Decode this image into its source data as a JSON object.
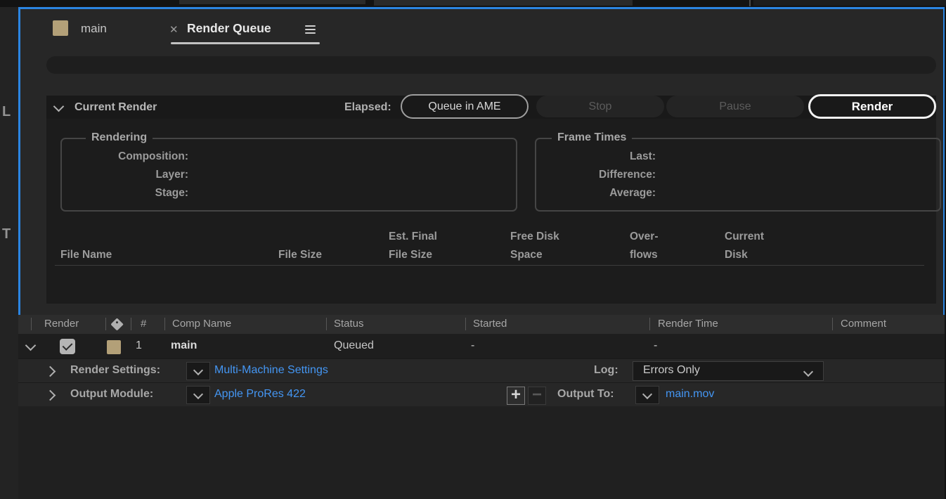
{
  "colors": {
    "focus_border": "#2b85e2",
    "link_blue": "#4496f3",
    "label_tan": "#b3a078",
    "panel_bg": "#272727",
    "section_bg": "#1c1c1c"
  },
  "edge": {
    "letter_top": "L",
    "letter_bottom": "T"
  },
  "tabs": {
    "comp_tab_label": "main",
    "close_glyph": "✕",
    "queue_tab_label": "Render Queue"
  },
  "current_render": {
    "title": "Current Render",
    "elapsed_label": "Elapsed:",
    "buttons": {
      "queue_in_ame": "Queue in AME",
      "stop": "Stop",
      "pause": "Pause",
      "render": "Render"
    },
    "rendering_group": {
      "title": "Rendering",
      "composition": "Composition:",
      "layer": "Layer:",
      "stage": "Stage:"
    },
    "frame_times_group": {
      "title": "Frame Times",
      "last": "Last:",
      "difference": "Difference:",
      "average": "Average:"
    },
    "file_columns": {
      "file_name": "File Name",
      "file_size": "File Size",
      "est_final_l1": "Est. Final",
      "est_final_l2": "File Size",
      "free_disk_l1": "Free Disk",
      "free_disk_l2": "Space",
      "overflows_l1": "Over-",
      "overflows_l2": "flows",
      "current_disk_l1": "Current",
      "current_disk_l2": "Disk"
    }
  },
  "queue": {
    "header": {
      "render": "Render",
      "hash": "#",
      "comp_name": "Comp Name",
      "status": "Status",
      "started": "Started",
      "render_time": "Render Time",
      "comment": "Comment"
    },
    "row": {
      "number": "1",
      "comp_name": "main",
      "status": "Queued",
      "started": "-",
      "render_time": "-"
    },
    "render_settings": {
      "label": "Render Settings:",
      "value": "Multi-Machine Settings",
      "log_label": "Log:",
      "log_value": "Errors Only"
    },
    "output_module": {
      "label": "Output Module:",
      "value": "Apple ProRes 422",
      "add_glyph": "+",
      "remove_glyph": "−",
      "output_to_label": "Output To:",
      "output_to_value": "main.mov"
    }
  }
}
